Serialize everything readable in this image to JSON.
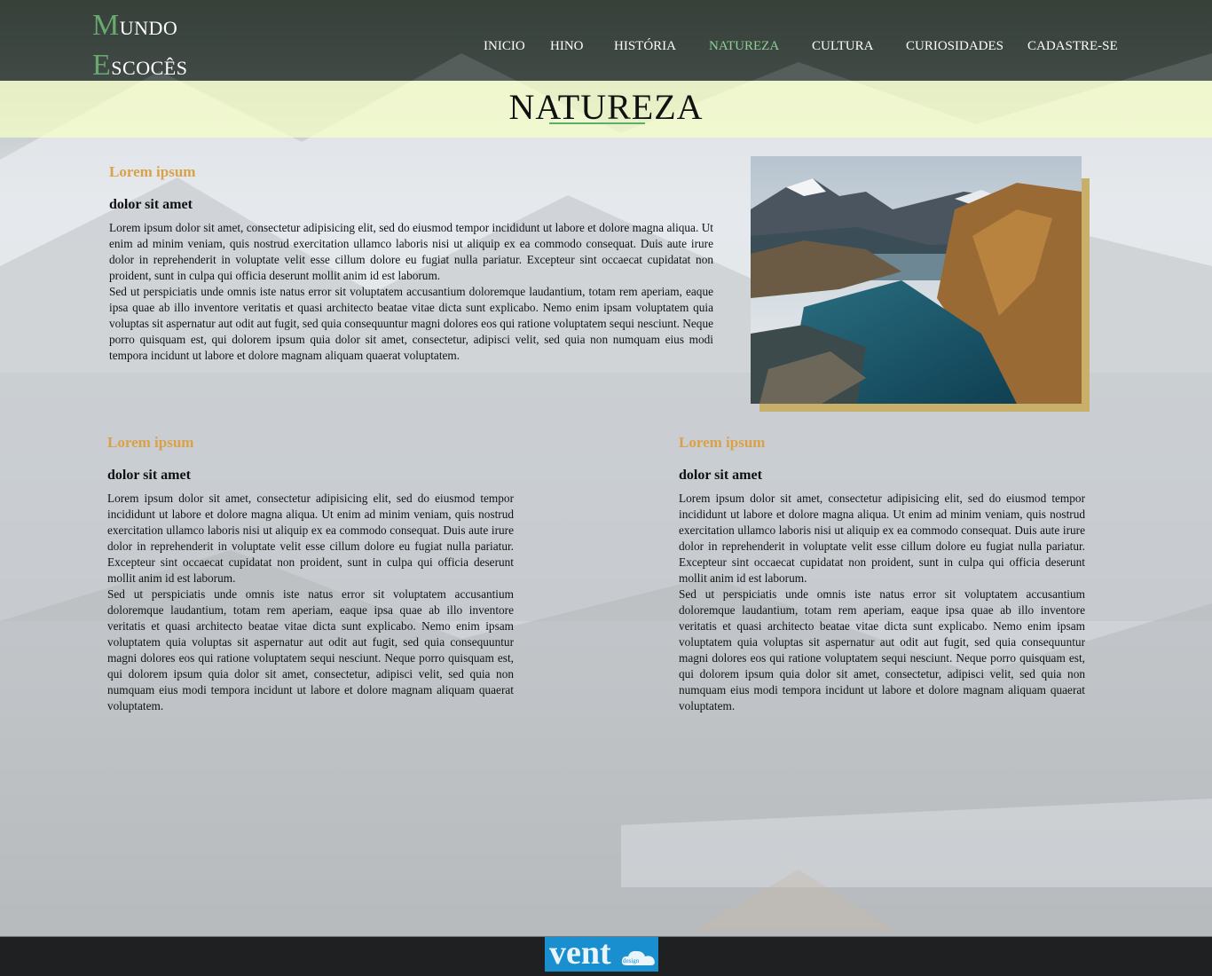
{
  "header": {
    "logo": {
      "line1_cap": "M",
      "line1_rest": "UNDO",
      "line2_cap": "E",
      "line2_rest": "SCOCÊS"
    },
    "nav": [
      {
        "label": "INICIO",
        "active": false
      },
      {
        "label": "HINO",
        "active": false
      },
      {
        "label": "HISTÓRIA",
        "active": false
      },
      {
        "label": "NATUREZA",
        "active": true
      },
      {
        "label": "CULTURA",
        "active": false
      },
      {
        "label": "CURIOSIDADES",
        "active": false
      },
      {
        "label": "CADASTRE-SE",
        "active": false
      }
    ]
  },
  "page": {
    "title": "NATUREZA"
  },
  "sections": [
    {
      "kicker": "Lorem ipsum",
      "subtitle": "dolor sit amet",
      "paragraph1": "Lorem ipsum dolor sit amet, consectetur adipisicing elit, sed do eiusmod tempor incididunt ut labore et dolore magna aliqua. Ut enim ad minim veniam, quis nostrud exercitation ullamco laboris nisi ut aliquip ex ea commodo consequat. Duis aute irure dolor in reprehenderit in voluptate velit esse cillum dolore eu fugiat nulla pariatur. Excepteur sint occaecat cupidatat non proident, sunt in culpa qui officia deserunt mollit anim id est laborum.",
      "paragraph2": "Sed ut perspiciatis unde omnis iste natus error sit voluptatem accusantium doloremque laudantium, totam rem aperiam, eaque ipsa quae ab illo inventore veritatis et quasi architecto beatae vitae dicta sunt explicabo. Nemo enim ipsam voluptatem quia voluptas sit aspernatur aut odit aut fugit, sed quia consequuntur magni dolores eos qui ratione voluptatem sequi nesciunt. Neque porro quisquam est, qui dolorem ipsum quia dolor sit amet, consectetur, adipisci velit, sed quia non numquam eius modi tempora incidunt ut labore et dolore magnam aliquam quaerat voluptatem."
    },
    {
      "kicker": "Lorem ipsum",
      "subtitle": "dolor sit amet",
      "paragraph1": "Lorem ipsum dolor sit amet, consectetur adipisicing elit, sed do eiusmod tempor incididunt ut labore et dolore magna aliqua. Ut enim ad minim veniam, quis nostrud exercitation ullamco laboris nisi ut aliquip ex ea commodo consequat. Duis aute irure dolor in reprehenderit in voluptate velit esse cillum dolore eu fugiat nulla pariatur. Excepteur sint occaecat cupidatat non proident, sunt in culpa qui officia deserunt mollit anim id est laborum.",
      "paragraph2": "Sed ut perspiciatis unde omnis iste natus error sit voluptatem accusantium doloremque laudantium, totam rem aperiam, eaque ipsa quae ab illo inventore veritatis et quasi architecto beatae vitae dicta sunt explicabo. Nemo enim ipsam voluptatem quia voluptas sit aspernatur aut odit aut fugit, sed quia consequuntur magni dolores eos qui ratione voluptatem sequi nesciunt. Neque porro quisquam est, qui dolorem ipsum quia dolor sit amet, consectetur, adipisci velit, sed quia non numquam eius modi tempora incidunt ut labore et dolore magnam aliquam quaerat voluptatem."
    },
    {
      "kicker": "Lorem ipsum",
      "subtitle": "dolor sit amet",
      "paragraph1": "Lorem ipsum dolor sit amet, consectetur adipisicing elit, sed do eiusmod tempor incididunt ut labore et dolore magna aliqua. Ut enim ad minim veniam, quis nostrud exercitation ullamco laboris nisi ut aliquip ex ea commodo consequat. Duis aute irure dolor in reprehenderit in voluptate velit esse cillum dolore eu fugiat nulla pariatur. Excepteur sint occaecat cupidatat non proident, sunt in culpa qui officia deserunt mollit anim id est laborum.",
      "paragraph2": "Sed ut perspiciatis unde omnis iste natus error sit voluptatem accusantium doloremque laudantium, totam rem aperiam, eaque ipsa quae ab illo inventore veritatis et quasi architecto beatae vitae dicta sunt explicabo. Nemo enim ipsam voluptatem quia voluptas sit aspernatur aut odit aut fugit, sed quia consequuntur magni dolores eos qui ratione voluptatem sequi nesciunt. Neque porro quisquam est, qui dolorem ipsum quia dolor sit amet, consectetur, adipisci velit, sed quia non numquam eius modi tempora incidunt ut labore et dolore magnam aliquam quaerat voluptatem."
    }
  ],
  "footer": {
    "brand_word": "vent",
    "brand_small": "design"
  },
  "colors": {
    "accent_green": "#8fd09a",
    "kicker_gold": "#d9a24a",
    "title_band": "#f4fcce",
    "photo_frame": "#c8b06a",
    "footer_logo_bg": "#1a8fd0"
  }
}
